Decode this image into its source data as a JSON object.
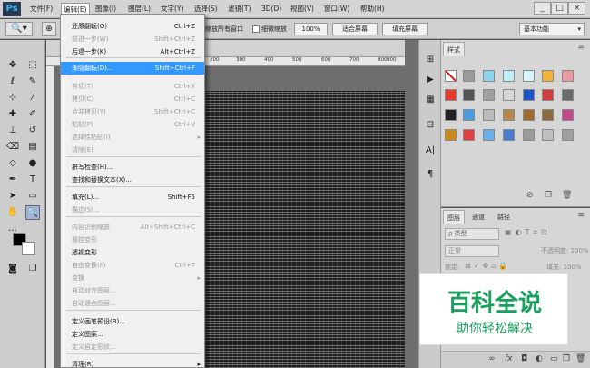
{
  "app": {
    "logo": "Ps"
  },
  "menubar": {
    "items": [
      "文件(F)",
      "编辑(E)",
      "图像(I)",
      "图层(L)",
      "文字(Y)",
      "选择(S)",
      "滤镜(T)",
      "3D(D)",
      "视图(V)",
      "窗口(W)",
      "帮助(H)"
    ],
    "window_buttons": [
      "_",
      "□",
      "×"
    ]
  },
  "options_bar": {
    "zoom_all": "缩放所有窗口",
    "scrubby_zoom": "细微缩放",
    "zoom_value": "100%",
    "fit_screen": "适合屏幕",
    "fill_screen": "填充屏幕",
    "workspace": "基本功能"
  },
  "rulers": {
    "top": [
      "200",
      "300",
      "400",
      "500",
      "600",
      "700",
      "800",
      "900"
    ]
  },
  "edit_menu": {
    "items": [
      {
        "label": "还原翻転(O)",
        "shortcut": "Ctrl+Z",
        "state": "normal"
      },
      {
        "label": "前进一步(W)",
        "shortcut": "Shift+Ctrl+Z",
        "state": "disabled"
      },
      {
        "label": "后退一步(K)",
        "shortcut": "Alt+Ctrl+Z",
        "state": "normal"
      },
      {
        "label": "渐隐翻転(D)...",
        "shortcut": "Shift+Ctrl+F",
        "state": "highlighted"
      },
      {
        "label": "剪切(T)",
        "shortcut": "Ctrl+X",
        "state": "disabled"
      },
      {
        "label": "拷贝(C)",
        "shortcut": "Ctrl+C",
        "state": "disabled"
      },
      {
        "label": "合并拷贝(Y)",
        "shortcut": "Shift+Ctrl+C",
        "state": "disabled"
      },
      {
        "label": "粘贴(P)",
        "shortcut": "Ctrl+V",
        "state": "disabled"
      },
      {
        "label": "选择性粘贴(I)",
        "shortcut": "",
        "state": "disabled",
        "submenu": true
      },
      {
        "label": "清除(E)",
        "shortcut": "",
        "state": "disabled"
      },
      {
        "label": "拼写检查(H)...",
        "shortcut": "",
        "state": "normal"
      },
      {
        "label": "查找和替换文本(X)...",
        "shortcut": "",
        "state": "normal"
      },
      {
        "label": "填充(L)...",
        "shortcut": "Shift+F5",
        "state": "normal"
      },
      {
        "label": "描边(S)...",
        "shortcut": "",
        "state": "disabled"
      },
      {
        "label": "内容识别缩放",
        "shortcut": "Alt+Shift+Ctrl+C",
        "state": "disabled"
      },
      {
        "label": "操控变形",
        "shortcut": "",
        "state": "disabled"
      },
      {
        "label": "透视变形",
        "shortcut": "",
        "state": "normal"
      },
      {
        "label": "自由变换(F)",
        "shortcut": "Ctrl+T",
        "state": "disabled"
      },
      {
        "label": "变换",
        "shortcut": "",
        "state": "disabled",
        "submenu": true
      },
      {
        "label": "自动对齐图层...",
        "shortcut": "",
        "state": "disabled"
      },
      {
        "label": "自动混合图层...",
        "shortcut": "",
        "state": "disabled"
      },
      {
        "label": "定义画笔预设(B)...",
        "shortcut": "",
        "state": "normal"
      },
      {
        "label": "定义图案...",
        "shortcut": "",
        "state": "normal"
      },
      {
        "label": "定义自定形状...",
        "shortcut": "",
        "state": "disabled"
      },
      {
        "label": "清理(R)",
        "shortcut": "",
        "state": "normal",
        "submenu": true
      }
    ]
  },
  "styles_panel": {
    "tab": "样式",
    "swatch_colors": [
      "#ffffff",
      "#9a9a9a",
      "#8fd4ee",
      "#bdeefa",
      "#d8f4fb",
      "#f2b33a",
      "#e89aa0",
      "#e63b2e",
      "#555555",
      "#a0a0a0",
      "#d8d8d8",
      "#1a56c8",
      "#d23c3c",
      "#6a6a6a",
      "#222222",
      "#4a9ee0",
      "#bbbbbb",
      "#b58a4a",
      "#a06a2a",
      "#8a6a3a",
      "#c24a8a",
      "#c8881a",
      "#e04040",
      "#6ab0e8",
      "#4a7ad0",
      "#9a9a9a",
      "#bfbfbf",
      "#a0a0a0"
    ]
  },
  "layers_panel": {
    "tabs": [
      "图层",
      "通道",
      "路径"
    ],
    "kind_label": "ρ 类型",
    "blend_mode": "正常",
    "opacity": "不透明度: 100%",
    "lock_label": "锁定:",
    "fill": "填充: 100%"
  },
  "watermark": {
    "title": "百科全说",
    "subtitle": "助你轻松解决"
  }
}
